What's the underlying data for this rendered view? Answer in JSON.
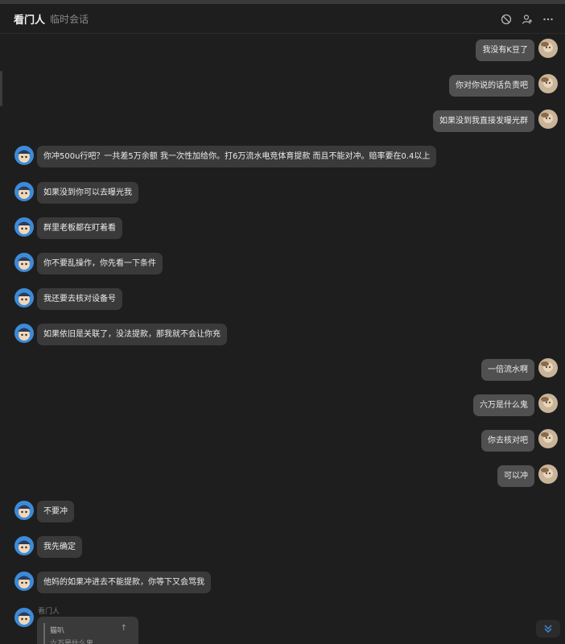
{
  "header": {
    "title": "看门人",
    "subtitle": "临时会话",
    "icons": [
      "block-icon",
      "add-user-icon",
      "more-icon"
    ]
  },
  "messages": [
    {
      "from": "me",
      "text": "我没有K豆了"
    },
    {
      "from": "me",
      "text": "你对你说的话负责吧"
    },
    {
      "from": "me",
      "text": "如果没到我直接发曝光群"
    },
    {
      "from": "other",
      "text": "你冲500u行吧？一共差5万余额 我一次性加给你。打6万流水电竞体育提款 而且不能对冲。赔率要在0.4以上"
    },
    {
      "from": "other",
      "text": "如果没到你可以去曝光我"
    },
    {
      "from": "other",
      "text": "群里老板都在盯着看"
    },
    {
      "from": "other",
      "text": "你不要乱操作，你先看一下条件"
    },
    {
      "from": "other",
      "text": "我还要去核对设备号"
    },
    {
      "from": "other",
      "text": "如果依旧是关联了，没法提款，那我就不会让你充"
    },
    {
      "from": "me",
      "text": "一倍流水啊"
    },
    {
      "from": "me",
      "text": "六万是什么鬼"
    },
    {
      "from": "me",
      "text": "你去核对吧"
    },
    {
      "from": "me",
      "text": "可以冲"
    },
    {
      "from": "other",
      "text": "不要冲"
    },
    {
      "from": "other",
      "text": "我先确定"
    },
    {
      "from": "other",
      "text": "他妈的如果冲进去不能提款，你等下又会骂我"
    }
  ],
  "last_message": {
    "sender": "看门人",
    "quote_name": "猫叭",
    "quote_text": "六万是什么鬼"
  },
  "colors": {
    "background": "#1e1e1e",
    "bubble_other": "#3a3a3a",
    "bubble_mine": "#505050",
    "accent": "#3d8bd8"
  }
}
